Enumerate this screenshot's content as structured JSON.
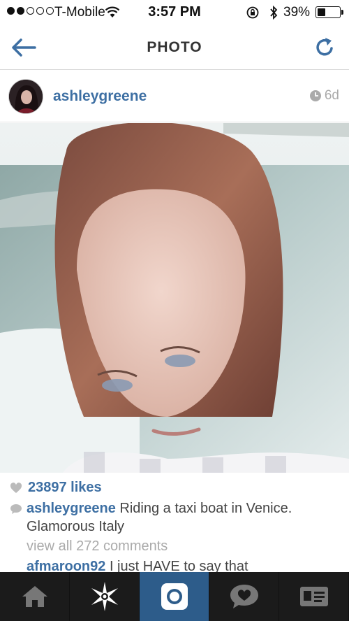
{
  "status_bar": {
    "carrier": "T-Mobile",
    "time": "3:57 PM",
    "battery_percent": "39%",
    "battery_level": 0.39,
    "signal_bars_filled": 2,
    "signal_bars_total": 5
  },
  "nav": {
    "title": "PHOTO",
    "back_icon": "back-arrow-icon",
    "refresh_icon": "refresh-icon"
  },
  "post": {
    "username": "ashleygreene",
    "time_ago": "6d",
    "likes": "23897 likes",
    "caption_user": "ashleygreene",
    "caption_text": "Riding a taxi boat in Venice. Glamorous Italy",
    "view_all_comments": "view all 272 comments",
    "first_comment_user": "afmaroon92",
    "first_comment_text": "I just HAVE to say that"
  },
  "tab_bar": {
    "items": [
      {
        "icon": "home-icon",
        "active": false
      },
      {
        "icon": "explore-icon",
        "active": false
      },
      {
        "icon": "camera-icon",
        "active": true
      },
      {
        "icon": "activity-icon",
        "active": false
      },
      {
        "icon": "profile-icon",
        "active": false
      }
    ]
  },
  "colors": {
    "accent": "#3d6fa3",
    "tab_bar_bg": "#1b1b1b",
    "tab_active_bg": "#2d5c8a"
  }
}
